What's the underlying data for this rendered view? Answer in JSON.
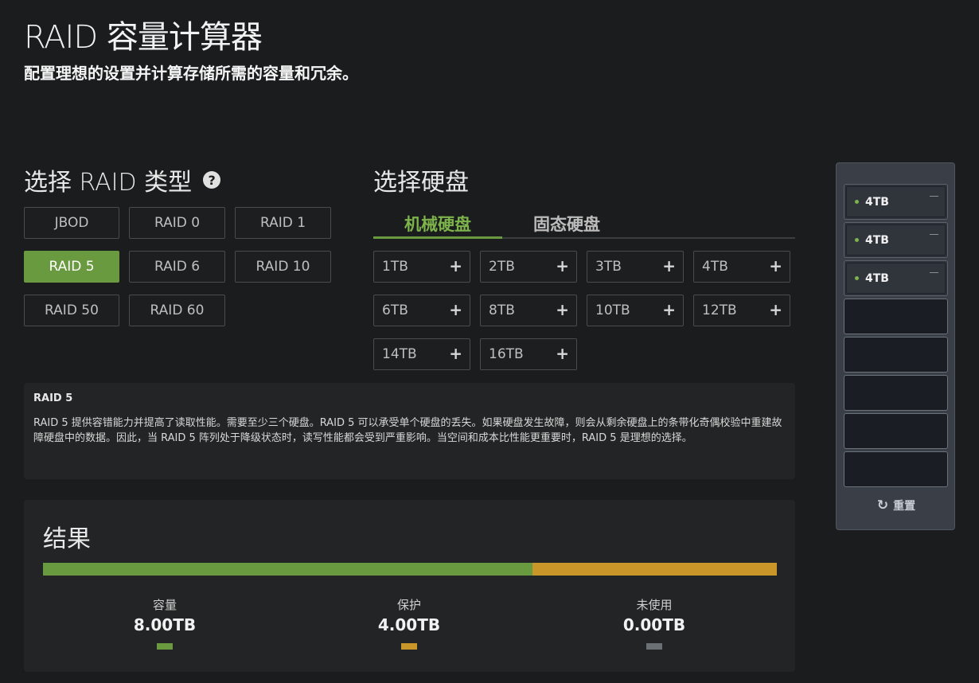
{
  "page": {
    "title": "RAID 容量计算器",
    "subtitle": "配置理想的设置并计算存储所需的容量和冗余。"
  },
  "raid_section": {
    "heading": "选择 RAID 类型",
    "help_icon": "question-circle-icon",
    "types": [
      "JBOD",
      "RAID 0",
      "RAID 1",
      "RAID 5",
      "RAID 6",
      "RAID 10",
      "RAID 50",
      "RAID 60"
    ],
    "selected": "RAID 5"
  },
  "disk_section": {
    "heading": "选择硬盘",
    "tabs": [
      "机械硬盘",
      "固态硬盘"
    ],
    "active_tab": "机械硬盘",
    "sizes": [
      "1TB",
      "2TB",
      "3TB",
      "4TB",
      "6TB",
      "8TB",
      "10TB",
      "12TB",
      "14TB",
      "16TB"
    ],
    "add_icon": "plus-icon"
  },
  "description": {
    "title": "RAID 5",
    "text": "RAID 5 提供容错能力并提高了读取性能。需要至少三个硬盘。RAID 5 可以承受单个硬盘的丢失。如果硬盘发生故障，则会从剩余硬盘上的条带化奇偶校验中重建故障硬盘中的数据。因此，当 RAID 5 阵列处于降级状态时，读写性能都会受到严重影响。当空间和成本比性能更重要时，RAID 5 是理想的选择。"
  },
  "results": {
    "title": "结果",
    "stats": [
      {
        "label": "容量",
        "value": "8.00TB",
        "color": "#6a9a3f",
        "fraction": 0.6667
      },
      {
        "label": "保护",
        "value": "4.00TB",
        "color": "#c9962a",
        "fraction": 0.3333
      },
      {
        "label": "未使用",
        "value": "0.00TB",
        "color": "#6b7075",
        "fraction": 0
      }
    ]
  },
  "bays": {
    "slots": [
      "4TB",
      "4TB",
      "4TB",
      "",
      "",
      "",
      "",
      ""
    ],
    "remove_icon": "minus-icon",
    "status_icon": "status-dot-icon",
    "reset_label": "重置",
    "reset_icon": "refresh-icon"
  },
  "colors": {
    "accent": "#6a9a3f",
    "protection": "#c9962a",
    "unused": "#6b7075"
  }
}
